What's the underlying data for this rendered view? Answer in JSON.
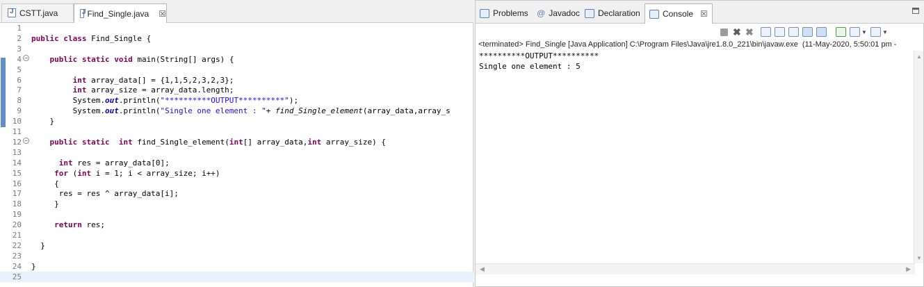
{
  "editor": {
    "tabs": [
      {
        "label": "CSTT.java",
        "active": false
      },
      {
        "label": "Find_Single.java",
        "active": true,
        "close": "☒"
      }
    ],
    "current_line": 25,
    "lines": [
      {
        "n": "1",
        "t": ""
      },
      {
        "n": "2",
        "t": "<span class=\"kw\">public</span> <span class=\"kw\">class</span> Find_Single {"
      },
      {
        "n": "3",
        "t": ""
      },
      {
        "n": "4",
        "fold": "⊖",
        "t": "    <span class=\"kw\">public</span> <span class=\"kw\">static</span> <span class=\"kw\">void</span> main(String[] args) {"
      },
      {
        "n": "5",
        "t": ""
      },
      {
        "n": "6",
        "t": "         <span class=\"kw\">int</span> array_data[] = {1,1,5,2,3,2,3};"
      },
      {
        "n": "7",
        "t": "         <span class=\"kw\">int</span> array_size = array_data.length;"
      },
      {
        "n": "8",
        "t": "         System.<span class=\"fld\">out</span>.println(<span class=\"str\">\"**********OUTPUT**********\"</span>);"
      },
      {
        "n": "9",
        "t": "         System.<span class=\"fld\">out</span>.println(<span class=\"str\">\"Single one element : \"</span>+ <span class=\"mth\">find_Single_element</span>(array_data,array_s"
      },
      {
        "n": "10",
        "t": "    }"
      },
      {
        "n": "11",
        "t": ""
      },
      {
        "n": "12",
        "fold": "⊖",
        "t": "    <span class=\"kw\">public</span> <span class=\"kw\">static</span>  <span class=\"kw\">int</span> find_Single_element(<span class=\"kw\">int</span>[] array_data,<span class=\"kw\">int</span> array_size) {"
      },
      {
        "n": "13",
        "t": ""
      },
      {
        "n": "14",
        "t": "      <span class=\"kw\">int</span> res = array_data[0];"
      },
      {
        "n": "15",
        "t": "     <span class=\"kw\">for</span> (<span class=\"kw\">int</span> i = 1; i &lt; array_size; i++)"
      },
      {
        "n": "16",
        "t": "     {"
      },
      {
        "n": "17",
        "t": "      res = res ^ array_data[i];"
      },
      {
        "n": "18",
        "t": "     }"
      },
      {
        "n": "19",
        "t": ""
      },
      {
        "n": "20",
        "t": "     <span class=\"kw\">return</span> res;"
      },
      {
        "n": "21",
        "t": ""
      },
      {
        "n": "22",
        "t": "  }"
      },
      {
        "n": "23",
        "t": ""
      },
      {
        "n": "24",
        "t": "}"
      },
      {
        "n": "25",
        "t": ""
      }
    ]
  },
  "views": {
    "tabs": [
      {
        "label": "Problems",
        "icon": "problems-icon"
      },
      {
        "label": "Javadoc",
        "icon": "at-icon"
      },
      {
        "label": "Declaration",
        "icon": "declaration-icon"
      },
      {
        "label": "Console",
        "icon": "console-icon",
        "active": true,
        "close": "☒"
      }
    ]
  },
  "console": {
    "header": "<terminated> Find_Single [Java Application] C:\\Program Files\\Java\\jre1.8.0_221\\bin\\javaw.exe  (11-May-2020, 5:50:01 pm -",
    "output": [
      "**********OUTPUT**********",
      "Single one element : 5"
    ]
  },
  "colors": {
    "keyword": "#7f0055",
    "string": "#2a00ff",
    "field": "#0000c0",
    "current_line": "#e8f2fe",
    "change_marker": "#5f8fc6"
  }
}
